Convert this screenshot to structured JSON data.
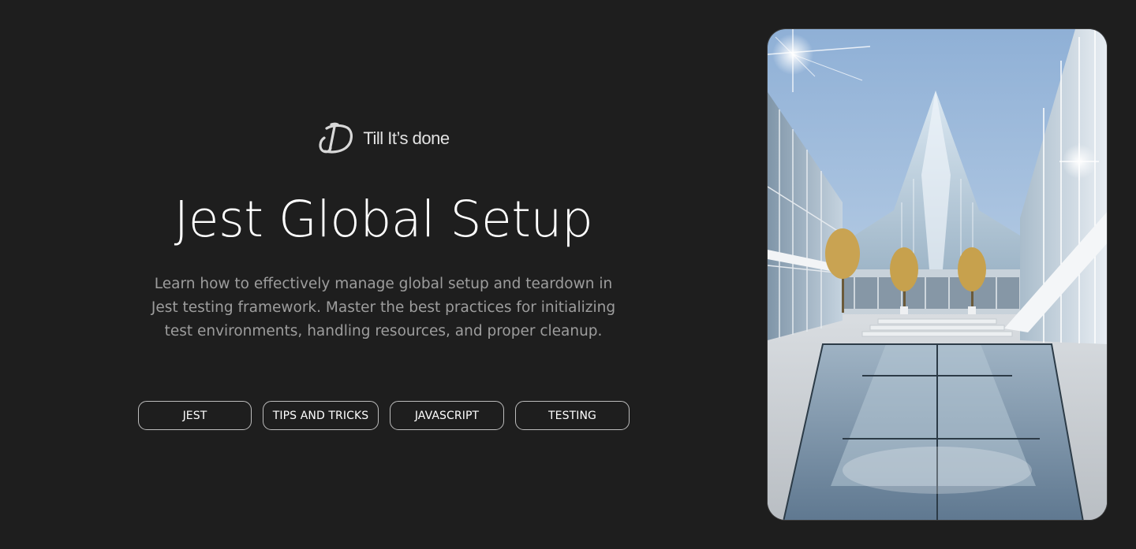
{
  "brand": {
    "name": "Till It’s done",
    "logo_icon": "td-monogram-icon"
  },
  "hero_text": {
    "title": "Jest Global Setup",
    "description": "Learn how to effectively manage global setup and teardown in Jest testing framework. Master the best practices for initializing test environments, handling resources, and proper cleanup."
  },
  "tags": [
    {
      "label": "JEST"
    },
    {
      "label": "TIPS AND TRICKS"
    },
    {
      "label": "JAVASCRIPT"
    },
    {
      "label": "TESTING"
    }
  ],
  "colors": {
    "background": "#1e1e1e",
    "text_primary": "#ffffff",
    "text_secondary": "#9d9d9d",
    "tag_border": "#bdbdbd"
  }
}
